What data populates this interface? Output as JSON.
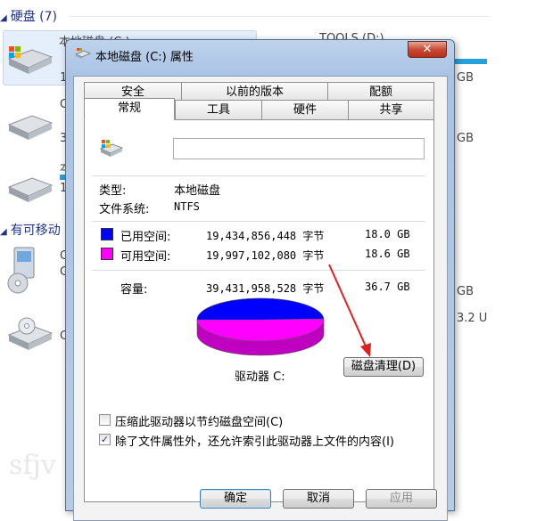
{
  "background": {
    "group_hard_drives": "硬盘 (7)",
    "group_removable": "有可移动",
    "drive_c_name": "本地磁盘 (C:)",
    "drive_d_name": "TOOLS (D:)",
    "size_snippets": [
      "GB",
      "GB",
      "GB",
      "3.2 U"
    ],
    "left_snippets": [
      "1",
      "C",
      "3",
      "本",
      "1",
      "C",
      "G",
      "C"
    ],
    "watermark": "sfjv"
  },
  "dialog": {
    "title": "本地磁盘 (C:) 属性",
    "close_glyph": "✕",
    "tabs_row1": [
      "安全",
      "以前的版本",
      "配额"
    ],
    "tabs_row2": [
      "常规",
      "工具",
      "硬件",
      "共享"
    ],
    "active_tab": "常规",
    "volume_name_value": "",
    "type_label": "类型:",
    "type_value": "本地磁盘",
    "fs_label": "文件系统:",
    "fs_value": "NTFS",
    "used_label": "已用空间:",
    "used_bytes": "19,434,856,448 字节",
    "used_gb": "18.0 GB",
    "free_label": "可用空间:",
    "free_bytes": "19,997,102,080 字节",
    "free_gb": "18.6 GB",
    "capacity_label": "容量:",
    "capacity_bytes": "39,431,958,528 字节",
    "capacity_gb": "36.7 GB",
    "drive_label": "驱动器 C:",
    "cleanup_button": "磁盘清理(D)",
    "compress_label": "压缩此驱动器以节约磁盘空间(C)",
    "compress_checked": false,
    "index_label": "除了文件属性外，还允许索引此驱动器上文件的内容(I)",
    "index_checked": true,
    "check_glyph": "✓",
    "ok_button": "确定",
    "cancel_button": "取消",
    "apply_button": "应用",
    "used_color": "#0000ff",
    "free_color": "#ff00ff",
    "used_fraction": 0.493
  }
}
